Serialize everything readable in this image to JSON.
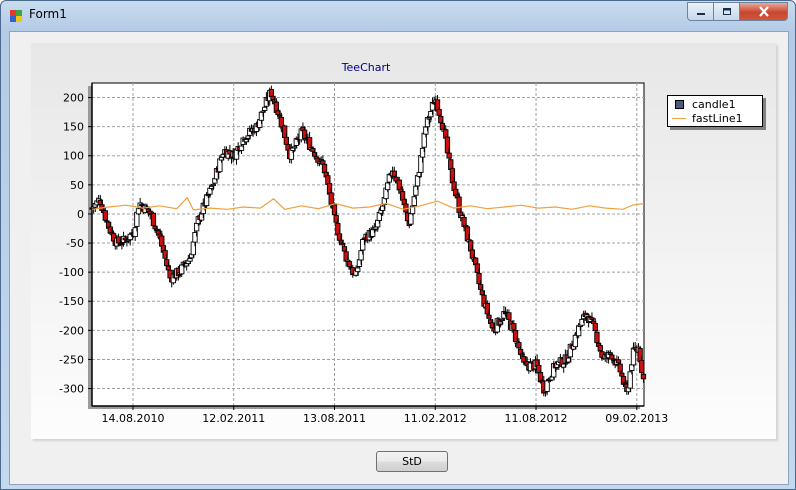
{
  "window": {
    "title": "Form1",
    "icon": "winforms-app-icon",
    "controls": [
      "minimize-icon",
      "maximize-icon",
      "close-icon"
    ]
  },
  "chart": {
    "title": "TeeChart",
    "legend": [
      {
        "label": "candle1",
        "color": "#4a5b7c"
      },
      {
        "label": "fastLine1",
        "color": "#f0a040"
      }
    ]
  },
  "button": {
    "label": "StD"
  },
  "chart_data": {
    "type": "candlestick",
    "title": "TeeChart",
    "legend_position": "top-right",
    "grid": true,
    "x_axis": {
      "type": "date",
      "range": [
        "2010-06-01",
        "2013-02-22"
      ],
      "tick_labels": [
        "14.08.2010",
        "12.02.2011",
        "13.08.2011",
        "11.02.2012",
        "11.08.2012",
        "09.02.2013"
      ],
      "tick_dates": [
        "2010-08-14",
        "2011-02-12",
        "2011-08-13",
        "2012-02-11",
        "2012-08-11",
        "2013-02-09"
      ]
    },
    "y_axis": {
      "range": [
        -330,
        225
      ],
      "ticks": [
        200,
        150,
        100,
        50,
        0,
        -50,
        -100,
        -150,
        -200,
        -250,
        -300
      ]
    },
    "series": [
      {
        "name": "candle1",
        "type": "candle",
        "up_color": "#ffffff",
        "down_color": "#cc1010",
        "close_anchors": [
          {
            "date": "2010-06-01",
            "value": 10
          },
          {
            "date": "2010-06-15",
            "value": 25
          },
          {
            "date": "2010-06-30",
            "value": -20
          },
          {
            "date": "2010-07-15",
            "value": -50
          },
          {
            "date": "2010-08-01",
            "value": -45
          },
          {
            "date": "2010-08-15",
            "value": -30
          },
          {
            "date": "2010-08-25",
            "value": 20
          },
          {
            "date": "2010-09-15",
            "value": 0
          },
          {
            "date": "2010-10-01",
            "value": -40
          },
          {
            "date": "2010-10-20",
            "value": -110
          },
          {
            "date": "2010-11-05",
            "value": -100
          },
          {
            "date": "2010-11-25",
            "value": -75
          },
          {
            "date": "2010-12-10",
            "value": -10
          },
          {
            "date": "2011-01-05",
            "value": 50
          },
          {
            "date": "2011-01-25",
            "value": 110
          },
          {
            "date": "2011-02-12",
            "value": 100
          },
          {
            "date": "2011-03-01",
            "value": 130
          },
          {
            "date": "2011-03-25",
            "value": 150
          },
          {
            "date": "2011-04-20",
            "value": 210
          },
          {
            "date": "2011-05-05",
            "value": 170
          },
          {
            "date": "2011-05-25",
            "value": 100
          },
          {
            "date": "2011-06-15",
            "value": 140
          },
          {
            "date": "2011-07-05",
            "value": 110
          },
          {
            "date": "2011-07-25",
            "value": 80
          },
          {
            "date": "2011-08-13",
            "value": -10
          },
          {
            "date": "2011-09-01",
            "value": -70
          },
          {
            "date": "2011-09-20",
            "value": -110
          },
          {
            "date": "2011-10-05",
            "value": -40
          },
          {
            "date": "2011-10-25",
            "value": -30
          },
          {
            "date": "2011-11-10",
            "value": 20
          },
          {
            "date": "2011-11-25",
            "value": 80
          },
          {
            "date": "2011-12-10",
            "value": 40
          },
          {
            "date": "2011-12-25",
            "value": -20
          },
          {
            "date": "2012-01-10",
            "value": 60
          },
          {
            "date": "2012-01-25",
            "value": 150
          },
          {
            "date": "2012-02-11",
            "value": 200
          },
          {
            "date": "2012-02-25",
            "value": 150
          },
          {
            "date": "2012-03-10",
            "value": 70
          },
          {
            "date": "2012-03-25",
            "value": 10
          },
          {
            "date": "2012-04-15",
            "value": -60
          },
          {
            "date": "2012-05-05",
            "value": -140
          },
          {
            "date": "2012-05-25",
            "value": -200
          },
          {
            "date": "2012-06-15",
            "value": -170
          },
          {
            "date": "2012-07-01",
            "value": -200
          },
          {
            "date": "2012-07-20",
            "value": -260
          },
          {
            "date": "2012-08-11",
            "value": -260
          },
          {
            "date": "2012-08-25",
            "value": -300
          },
          {
            "date": "2012-09-15",
            "value": -260
          },
          {
            "date": "2012-10-05",
            "value": -250
          },
          {
            "date": "2012-10-25",
            "value": -200
          },
          {
            "date": "2012-11-10",
            "value": -170
          },
          {
            "date": "2012-11-25",
            "value": -200
          },
          {
            "date": "2012-12-10",
            "value": -250
          },
          {
            "date": "2012-12-25",
            "value": -240
          },
          {
            "date": "2013-01-10",
            "value": -270
          },
          {
            "date": "2013-01-22",
            "value": -310
          },
          {
            "date": "2013-02-02",
            "value": -240
          },
          {
            "date": "2013-02-12",
            "value": -230
          },
          {
            "date": "2013-02-22",
            "value": -290
          }
        ]
      },
      {
        "name": "fastLine1",
        "type": "line",
        "color": "#f0a040",
        "points": [
          {
            "date": "2010-06-01",
            "value": 8
          },
          {
            "date": "2010-07-01",
            "value": 12
          },
          {
            "date": "2010-08-01",
            "value": 15
          },
          {
            "date": "2010-09-01",
            "value": 10
          },
          {
            "date": "2010-10-01",
            "value": 14
          },
          {
            "date": "2010-11-01",
            "value": 9
          },
          {
            "date": "2010-11-20",
            "value": 28
          },
          {
            "date": "2010-12-01",
            "value": 7
          },
          {
            "date": "2011-01-01",
            "value": 10
          },
          {
            "date": "2011-02-01",
            "value": 8
          },
          {
            "date": "2011-03-01",
            "value": 12
          },
          {
            "date": "2011-04-01",
            "value": 10
          },
          {
            "date": "2011-04-25",
            "value": 26
          },
          {
            "date": "2011-05-15",
            "value": 8
          },
          {
            "date": "2011-06-15",
            "value": 14
          },
          {
            "date": "2011-07-15",
            "value": 9
          },
          {
            "date": "2011-08-15",
            "value": 18
          },
          {
            "date": "2011-09-15",
            "value": 10
          },
          {
            "date": "2011-10-15",
            "value": 12
          },
          {
            "date": "2011-11-15",
            "value": 18
          },
          {
            "date": "2011-12-15",
            "value": 8
          },
          {
            "date": "2012-01-15",
            "value": 14
          },
          {
            "date": "2012-02-15",
            "value": 22
          },
          {
            "date": "2012-03-15",
            "value": 10
          },
          {
            "date": "2012-04-15",
            "value": 14
          },
          {
            "date": "2012-05-15",
            "value": 9
          },
          {
            "date": "2012-06-15",
            "value": 12
          },
          {
            "date": "2012-07-15",
            "value": 15
          },
          {
            "date": "2012-08-15",
            "value": 10
          },
          {
            "date": "2012-09-15",
            "value": 12
          },
          {
            "date": "2012-10-15",
            "value": 8
          },
          {
            "date": "2012-11-15",
            "value": 14
          },
          {
            "date": "2012-12-15",
            "value": 10
          },
          {
            "date": "2013-01-15",
            "value": 8
          },
          {
            "date": "2013-02-01",
            "value": 15
          },
          {
            "date": "2013-02-22",
            "value": 18
          }
        ]
      }
    ]
  }
}
